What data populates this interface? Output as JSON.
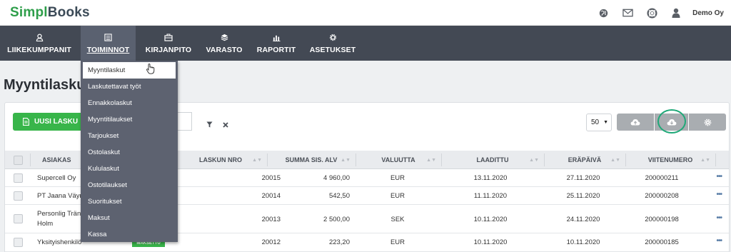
{
  "header": {
    "logo_part1": "Simpl",
    "logo_part2": "Books",
    "icons": [
      "globe-icon",
      "mail-icon",
      "lifebuoy-icon",
      "user-icon"
    ],
    "company": "Demo Oy"
  },
  "nav": {
    "items": [
      {
        "label": "LIIKEKUMPPANIT",
        "icon": "partner-icon"
      },
      {
        "label": "TOIMINNOT",
        "icon": "calculator-icon",
        "active": true
      },
      {
        "label": "KIRJANPITO",
        "icon": "briefcase-icon"
      },
      {
        "label": "VARASTO",
        "icon": "boxes-icon"
      },
      {
        "label": "RAPORTIT",
        "icon": "bar-chart-icon"
      },
      {
        "label": "ASETUKSET",
        "icon": "gear-icon"
      }
    ]
  },
  "dropdown": {
    "items": [
      "Myyntilaskut",
      "Laskutettavat työt",
      "Ennakkolaskut",
      "Myyntitilaukset",
      "Tarjoukset",
      "Ostolaskut",
      "Kululaskut",
      "Ostotilaukset",
      "Suoritukset",
      "Maksut",
      "Kassa"
    ]
  },
  "page": {
    "title": "Myyntilaskut"
  },
  "toolbar": {
    "new_label": "UUSI LASKU",
    "per_page": "50",
    "buttons": [
      "cloud-upload-icon",
      "cloud-download-icon",
      "gear-icon"
    ]
  },
  "table": {
    "columns": [
      "ASIAKAS",
      "LASKUN NRO",
      "SUMMA SIS. ALV",
      "VALUUTTA",
      "LAADITTU",
      "ERÄPÄIVÄ",
      "VIITENUMERO"
    ],
    "rows": [
      {
        "customer": "Supercell Oy",
        "customer2": "",
        "number": "20015",
        "sum": "4 960,00",
        "currency": "EUR",
        "created": "13.11.2020",
        "due": "27.11.2020",
        "ref": "200000211"
      },
      {
        "customer": "PT Jaana Väyry",
        "customer2": "",
        "number": "20014",
        "sum": "542,50",
        "currency": "EUR",
        "created": "11.11.2020",
        "due": "25.11.2020",
        "ref": "200000208"
      },
      {
        "customer": "Personlig Trän",
        "customer2": "Holm",
        "number": "20013",
        "sum": "2 500,00",
        "currency": "SEK",
        "created": "10.11.2020",
        "due": "24.11.2020",
        "ref": "200000198"
      },
      {
        "customer": "Yksityishenkilö",
        "customer2": "",
        "number": "20012",
        "sum": "223,20",
        "currency": "EUR",
        "created": "10.11.2020",
        "due": "10.11.2020",
        "ref": "200000185"
      }
    ],
    "badge": "MAKSETTU",
    "row_menu": "•••"
  },
  "colors": {
    "brand_green": "#2e9e4a",
    "nav_bg": "#434954",
    "dropdown_bg": "#5d6270",
    "primary_button": "#38b54a",
    "highlight_ring": "#1fa878"
  }
}
